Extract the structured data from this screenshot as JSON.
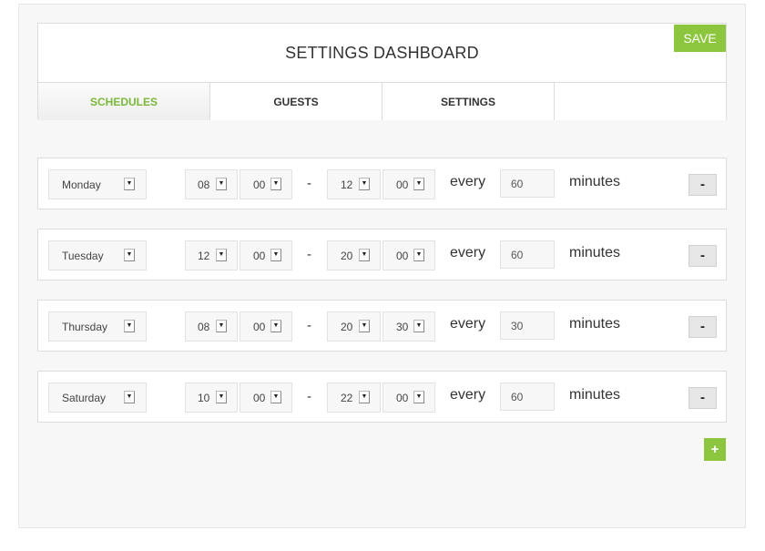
{
  "header": {
    "title": "SETTINGS DASHBOARD",
    "save_label": "SAVE"
  },
  "tabs": [
    {
      "label": "SCHEDULES",
      "active": true
    },
    {
      "label": "GUESTS",
      "active": false
    },
    {
      "label": "SETTINGS",
      "active": false
    }
  ],
  "colors": {
    "accent": "#8cc63f",
    "active_tab_text": "#7ab83a"
  },
  "schedules": [
    {
      "day": "Monday",
      "start_hour": "08",
      "start_min": "00",
      "end_hour": "12",
      "end_min": "00",
      "every_label": "every",
      "interval": "60",
      "unit_label": "minutes",
      "remove_label": "-"
    },
    {
      "day": "Tuesday",
      "start_hour": "12",
      "start_min": "00",
      "end_hour": "20",
      "end_min": "00",
      "every_label": "every",
      "interval": "60",
      "unit_label": "minutes",
      "remove_label": "-"
    },
    {
      "day": "Thursday",
      "start_hour": "08",
      "start_min": "00",
      "end_hour": "20",
      "end_min": "30",
      "every_label": "every",
      "interval": "30",
      "unit_label": "minutes",
      "remove_label": "-"
    },
    {
      "day": "Saturday",
      "start_hour": "10",
      "start_min": "00",
      "end_hour": "22",
      "end_min": "00",
      "every_label": "every",
      "interval": "60",
      "unit_label": "minutes",
      "remove_label": "-"
    }
  ],
  "separator": "-",
  "add_label": "+"
}
